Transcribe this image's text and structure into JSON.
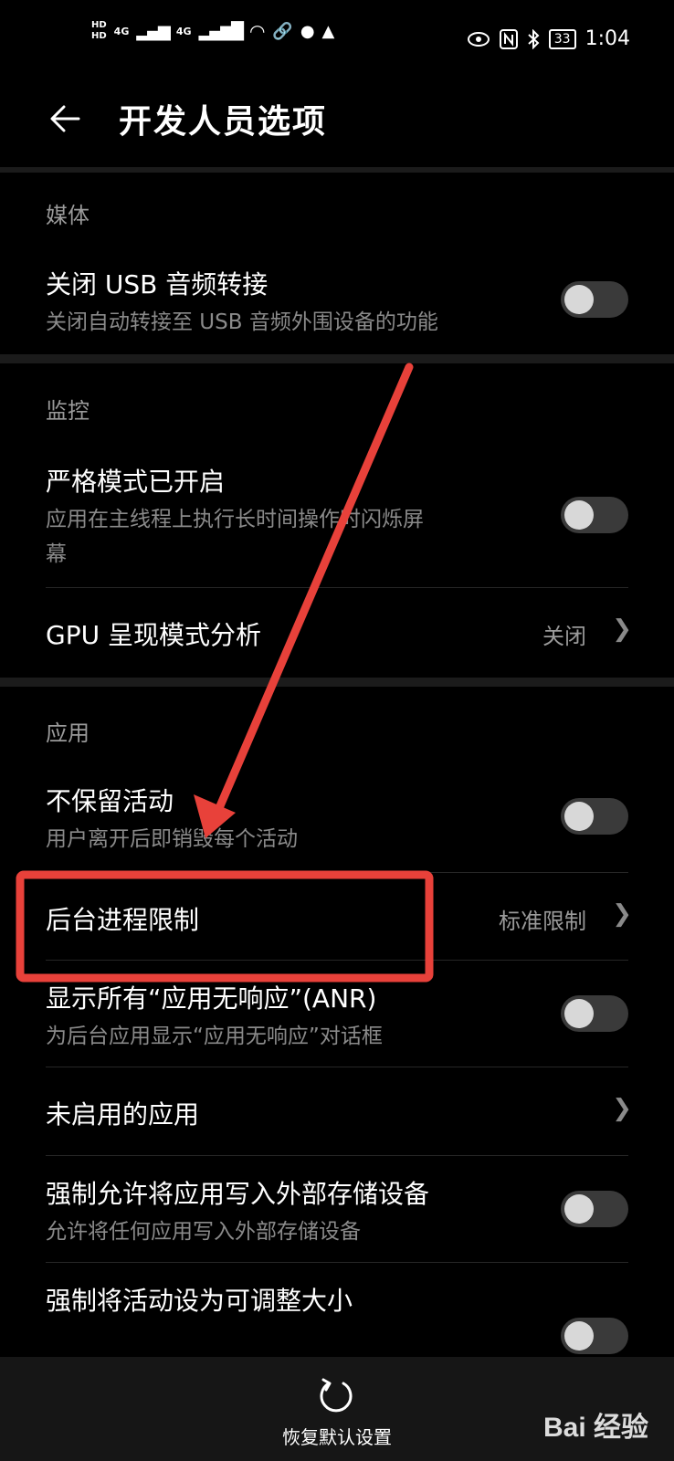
{
  "status_bar": {
    "hd1": "HD",
    "hd2": "HD",
    "net1": "4G",
    "net2": "4G",
    "battery": "33",
    "time": "1:04"
  },
  "header": {
    "title": "开发人员选项",
    "back_icon": "arrow-left-icon"
  },
  "sections": {
    "media": {
      "label": "媒体",
      "usb_audio": {
        "title": "关闭 USB 音频转接",
        "subtitle": "关闭自动转接至 USB 音频外围设备的功能",
        "on": false
      }
    },
    "monitor": {
      "label": "监控",
      "strict_mode": {
        "title": "严格模式已开启",
        "subtitle_line1": "应用在主线程上执行长时间操作时闪烁屏",
        "subtitle_line2": "幕",
        "on": false
      },
      "gpu": {
        "title": "GPU 呈现模式分析",
        "value": "关闭"
      }
    },
    "apps": {
      "label": "应用",
      "dont_keep": {
        "title": "不保留活动",
        "subtitle": "用户离开后即销毁每个活动",
        "on": false
      },
      "bg_limit": {
        "title": "后台进程限制",
        "value": "标准限制"
      },
      "anr": {
        "title": "显示所有“应用无响应”(ANR)",
        "subtitle": "为后台应用显示“应用无响应”对话框",
        "on": false
      },
      "inactive": {
        "title": "未启用的应用"
      },
      "force_external": {
        "title": "强制允许将应用写入外部存储设备",
        "subtitle": "允许将任何应用写入外部存储设备",
        "on": false
      },
      "resizable": {
        "title": "强制将活动设为可调整大小"
      }
    }
  },
  "bottom": {
    "reset_label": "恢复默认设置",
    "reset_icon": "refresh-icon"
  },
  "watermark": "Bai 经验",
  "annotation_color": "#e8413a"
}
